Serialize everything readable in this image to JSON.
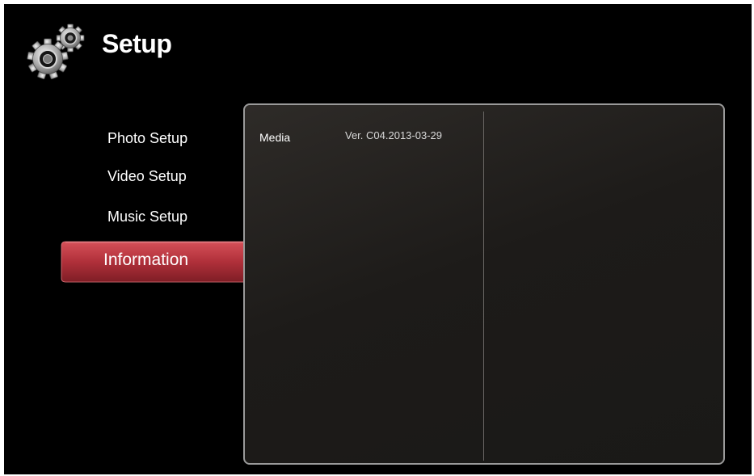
{
  "header": {
    "title": "Setup",
    "icon": "gears-icon"
  },
  "menu": {
    "items": [
      {
        "label": "Photo Setup",
        "selected": false
      },
      {
        "label": "Video Setup",
        "selected": false
      },
      {
        "label": "Music Setup",
        "selected": false
      },
      {
        "label": "Information",
        "selected": true
      }
    ]
  },
  "info": {
    "rows": [
      {
        "label": "Media",
        "value": "Ver. C04.2013-03-29"
      }
    ]
  },
  "colors": {
    "background": "#000000",
    "highlight": "#b5313a",
    "panel_border": "#9a9a9a",
    "panel_background": "#1d1b19",
    "text": "#ffffff"
  }
}
